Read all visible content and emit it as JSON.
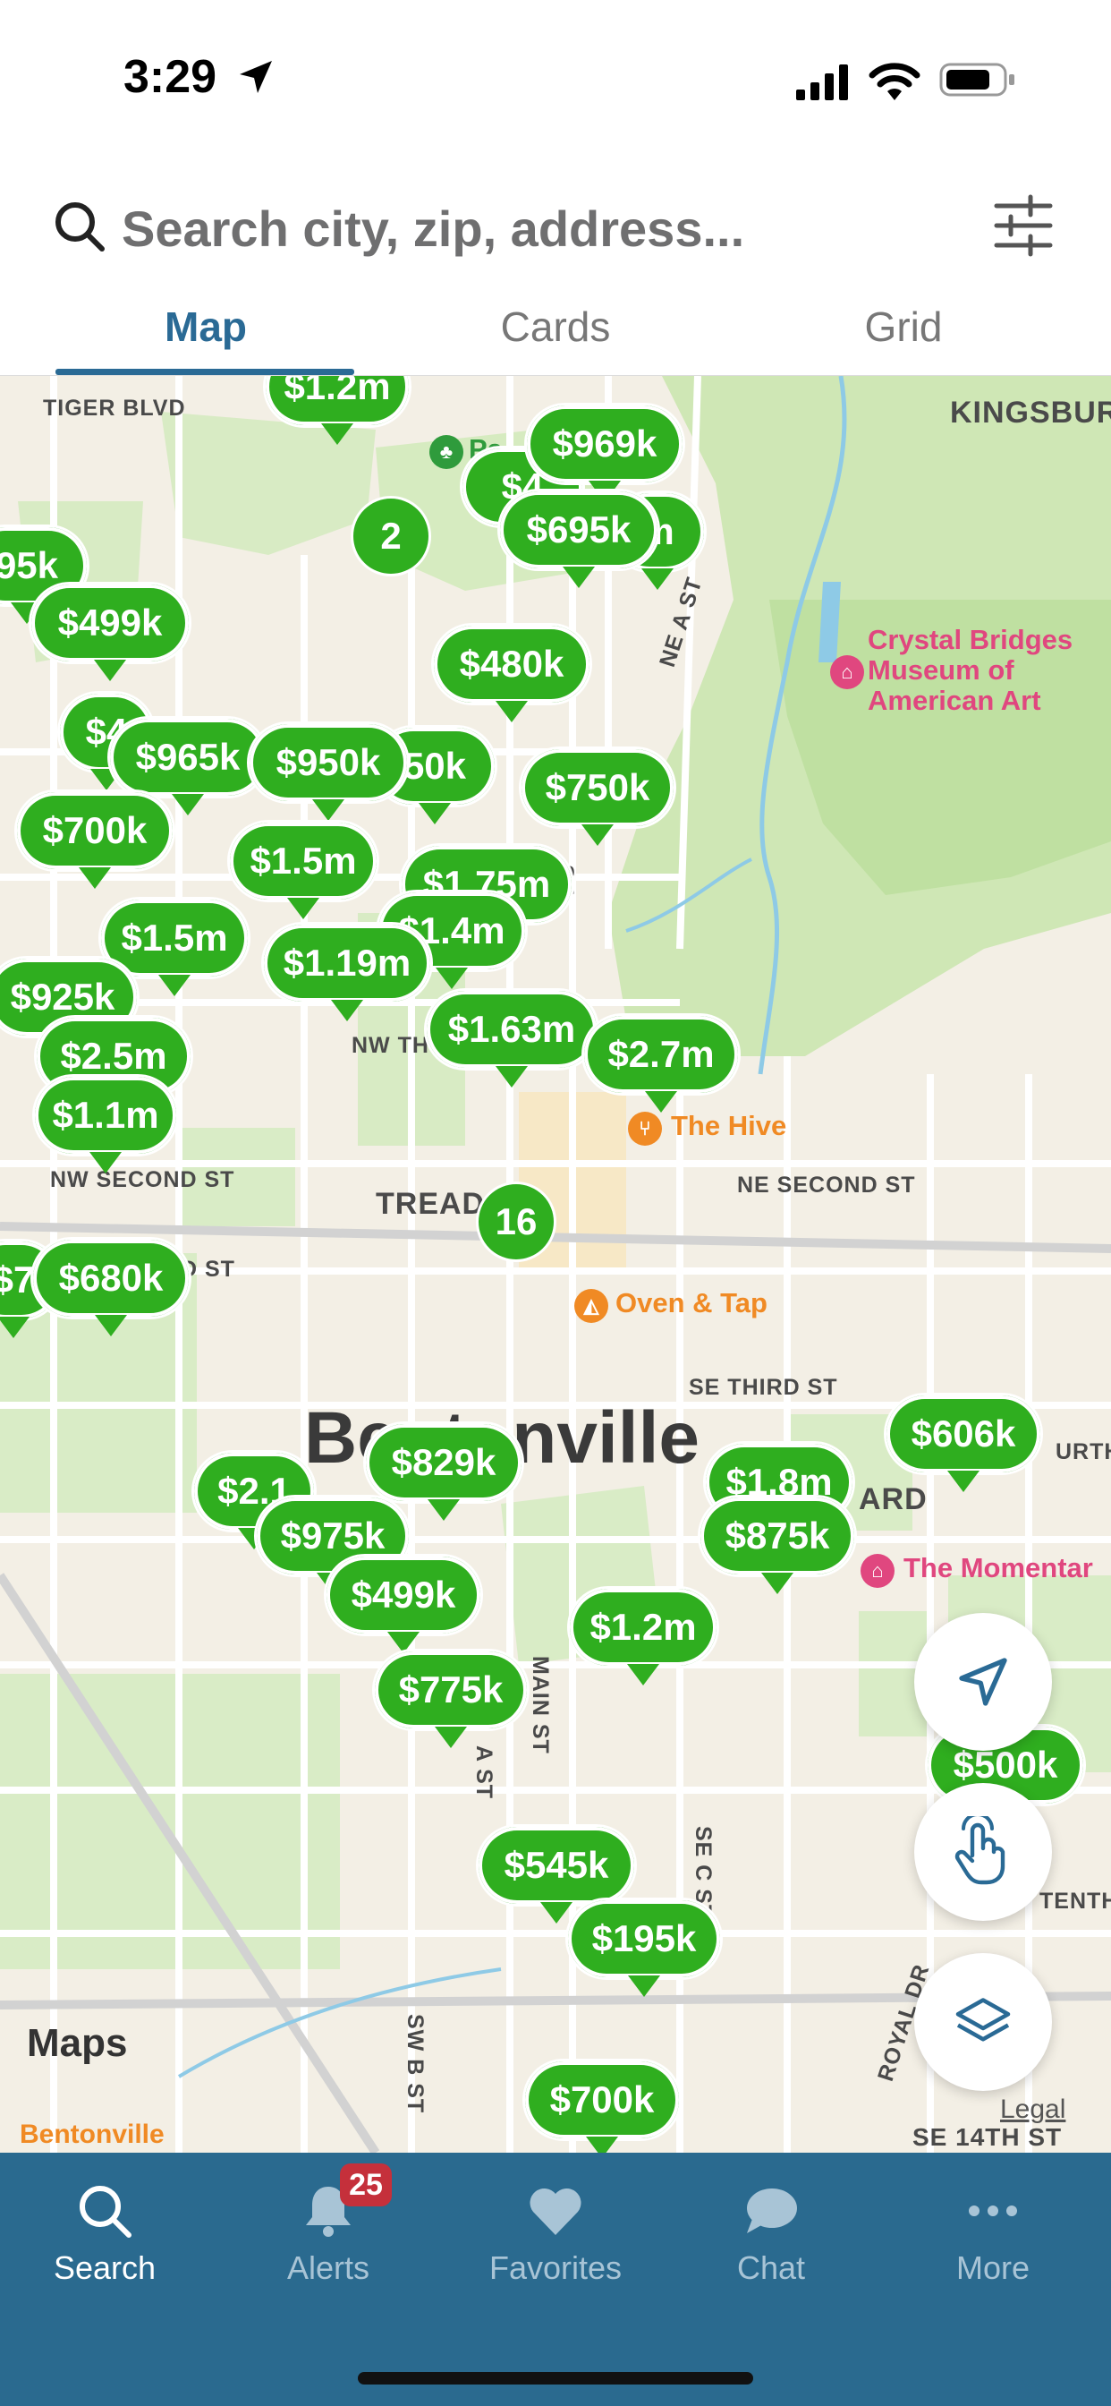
{
  "status": {
    "time": "3:29"
  },
  "search": {
    "placeholder": "Search city, zip, address..."
  },
  "tabs": [
    {
      "label": "Map",
      "active": true
    },
    {
      "label": "Cards",
      "active": false
    },
    {
      "label": "Grid",
      "active": false
    }
  ],
  "map": {
    "city": "Bentonville",
    "streets": {
      "tiger_blvd": "TIGER BLVD",
      "kingsbury": "KINGSBURY",
      "ne_a_st": "NE A ST",
      "nw_second": "NW SECOND ST",
      "ne_second": "NE SECOND ST",
      "tread": "TREAD",
      "se_third": "SE THIRD ST",
      "main_st": "MAIN ST",
      "a_st": "A ST",
      "se_c_st": "SE C ST",
      "sw_b_st": "SW B ST",
      "royal_dr": "ROYAL DR",
      "se_14th": "SE 14TH ST",
      "tenth": "TENTH",
      "urth": "URTH",
      "ard": "ARD",
      "nw_th": "NW TH",
      "d_st": "D ST",
      "st": "ST"
    },
    "pois": {
      "crystal_bridges": "Crystal Bridges\nMuseum of\nAmerican Art",
      "the_hive": "The Hive",
      "oven_tap": "Oven & Tap",
      "the_momentary": "The Momentar",
      "bentonville_bottom": "Bentonville",
      "pa": "Pa"
    },
    "pins": {
      "p1": "$1.2m",
      "p2": "$969k",
      "p3": "$695k",
      "p4": "$499k",
      "p5": "$480k",
      "p6": "$965k",
      "p7": "$950k",
      "p8": "$750k",
      "p9": "$700k",
      "p10": "$1.5m",
      "p11": "$1.5m",
      "p12": "$1.19m",
      "p13": "$1.4m",
      "p14": "$1.75m",
      "p15": "$925k",
      "p16": "$2.5m",
      "p17": "$1.63m",
      "p18": "$2.7m",
      "p19": "$680k",
      "p20": "$829k",
      "p21": "$975k",
      "p22": "$499k",
      "p23": "$606k",
      "p24": "$875k",
      "p25": "$1.8m",
      "p26": "$1.2m",
      "p27": "$775k",
      "p28": "$500k",
      "p29": "$545k",
      "p30": "$195k",
      "p31": "$700k",
      "p32": "$2.1",
      "p33": "95k",
      "p34": "$4",
      "p35": "$4",
      "p36": "50k",
      "p37": "$1.1m",
      "p38": "$7",
      "p39": "m"
    },
    "clusters": {
      "c1": "2",
      "c2": "16"
    },
    "brand": "Maps",
    "legal": "Legal"
  },
  "tabbar": {
    "items": [
      {
        "label": "Search",
        "icon": "search-icon",
        "active": true
      },
      {
        "label": "Alerts",
        "icon": "bell-icon",
        "active": false
      },
      {
        "label": "Favorites",
        "icon": "heart-icon",
        "active": false
      },
      {
        "label": "Chat",
        "icon": "chat-icon",
        "active": false
      },
      {
        "label": "More",
        "icon": "more-icon",
        "active": false
      }
    ],
    "alerts_badge": "25"
  },
  "colors": {
    "accent": "#2a6a95",
    "pin": "#2fae1f",
    "tabbar": "#2a6a8f",
    "badge": "#c5303b"
  }
}
